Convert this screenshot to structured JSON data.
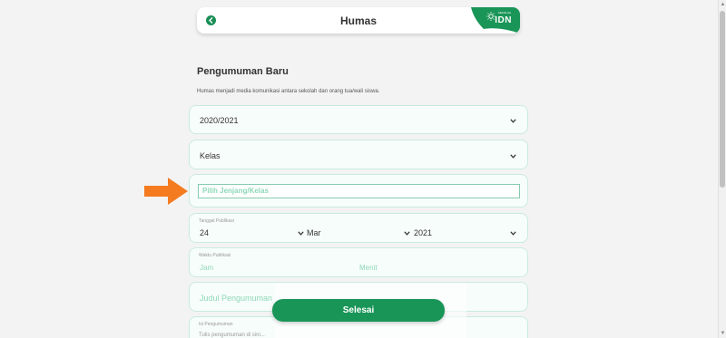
{
  "header": {
    "title": "Humas",
    "logo_text": "IDN",
    "logo_small_text": "SEKOLAH"
  },
  "form": {
    "title": "Pengumuman Baru",
    "description": "Humas menjadi media komunikasi antara sekolah dan orang tua/wali siswa.",
    "year_select": {
      "value": "2020/2021"
    },
    "class_select": {
      "value": "Kelas"
    },
    "jenjang_input": {
      "placeholder": "Pilih Jenjang/Kelas"
    },
    "publish_date": {
      "label": "Tanggal Publikasi",
      "day": "24",
      "month": "Mar",
      "year": "2021"
    },
    "publish_time": {
      "label": "Waktu Publikasi",
      "hour_placeholder": "Jam",
      "minute_placeholder": "Menit"
    },
    "title_input": {
      "placeholder": "Judul Pengumuman"
    },
    "body_input": {
      "label": "Isi Pengumuman",
      "placeholder": "Tulis pengumuman di sini..."
    },
    "submit_label": "Selesai"
  },
  "colors": {
    "brand_green": "#1a9558",
    "field_border": "#c9ebdf",
    "field_bg": "#f7fdfb",
    "placeholder_green": "#8ed8b8",
    "annotation_arrow": "#f47b20"
  }
}
